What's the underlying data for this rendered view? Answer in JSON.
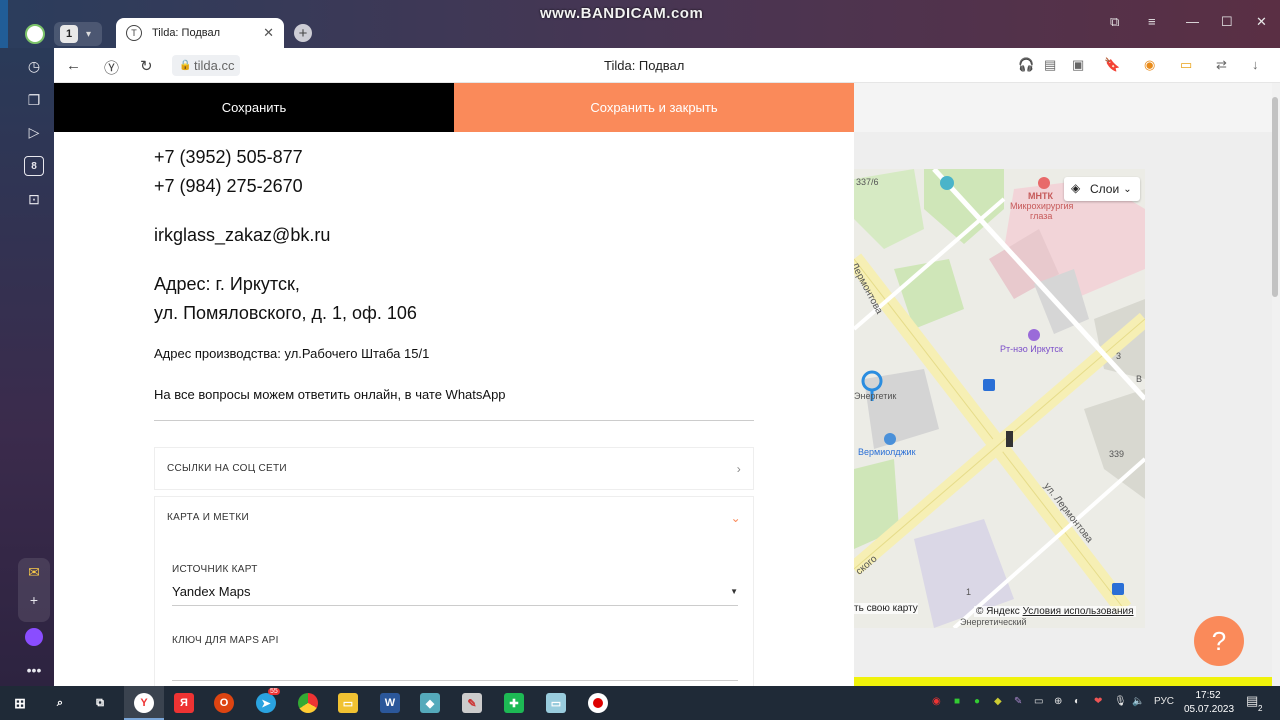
{
  "browser": {
    "tab_count": "1",
    "tab_title": "Tilda: Подвал",
    "url": "tilda.cc",
    "page_title": "Tilda: Подвал",
    "watermark": "www.BANDICAM.com",
    "rail_badge": "8"
  },
  "editor": {
    "save_label": "Сохранить",
    "save_close_label": "Сохранить и закрыть",
    "phone1": "+7 (3952) 505-877",
    "phone2": "+7 (984) 275-2670",
    "email": "irkglass_zakaz@bk.ru",
    "address1": "Адрес: г. Иркутск,",
    "address2": "ул. Помяловского, д. 1, оф. 106",
    "production": "Адрес производства: ул.Рабочего Штаба 15/1",
    "online": "На все вопросы можем ответить онлайн, в чате WhatsApp",
    "social_panel": "ССЫЛКИ НА СОЦ СЕТИ",
    "map_panel": "КАРТА И МЕТКИ",
    "map_source_label": "ИСТОЧНИК КАРТ",
    "map_source_value": "Yandex Maps",
    "api_key_label": "КЛЮЧ ДЛЯ MAPS API"
  },
  "map": {
    "layers_label": "Слои",
    "street1": "Лермонтова",
    "street2": "ул. Лермонтова",
    "street3": "ского",
    "house1": "337/6",
    "poi1": "МНТК",
    "poi2": "Микрохирургия",
    "poi3": "глаза",
    "poi4": "Рт-нэо Иркутск",
    "poi5": "Энергетик",
    "poi6": "Вермиолджик",
    "house2": "339",
    "house3": "3",
    "house4": "1",
    "edge_b": "В",
    "bottom_label": "Энергетический",
    "edit_link": "ть свою карту",
    "copyright": "© Яндекс",
    "terms": "Условия использования"
  },
  "help_label": "?",
  "taskbar": {
    "lang": "РУС",
    "time": "17:52",
    "date": "05.07.2023",
    "notify": "2",
    "telegram_badge": "55"
  }
}
